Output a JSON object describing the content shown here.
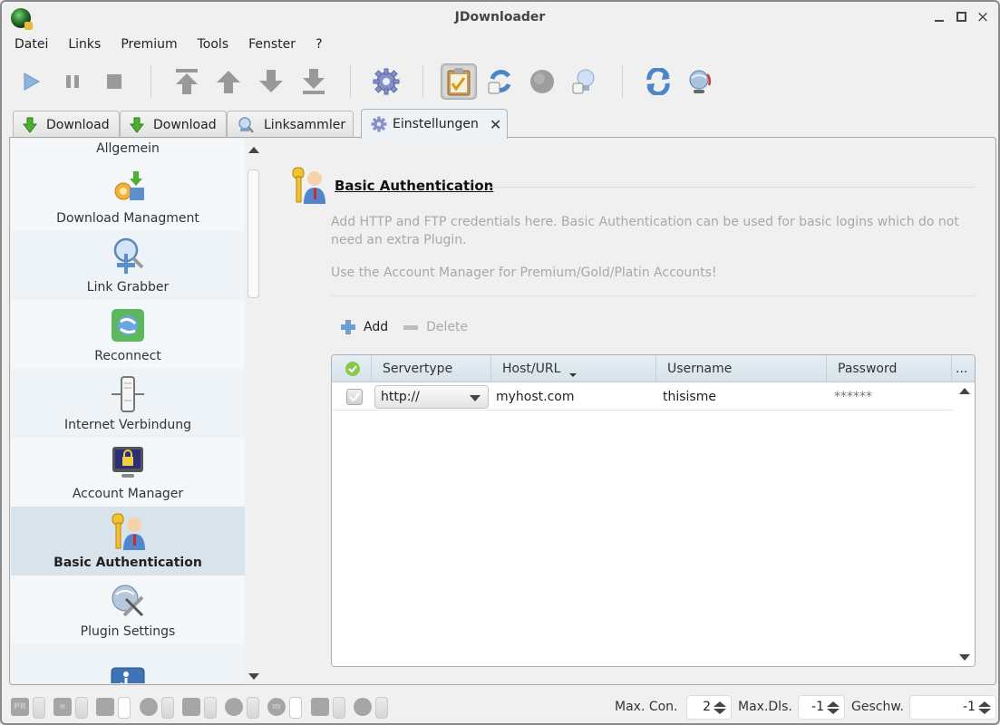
{
  "window": {
    "title": "JDownloader",
    "controls": {
      "minimize": "minimize",
      "maximize": "maximize",
      "close": "×"
    }
  },
  "menu": [
    "Datei",
    "Links",
    "Premium",
    "Tools",
    "Fenster",
    "?"
  ],
  "toolbar": {
    "buttons": [
      {
        "name": "play-icon",
        "tooltip": "Start"
      },
      {
        "name": "pause-icon",
        "tooltip": "Pause"
      },
      {
        "name": "stop-icon",
        "tooltip": "Stop"
      },
      {
        "name": "move-top-icon",
        "tooltip": "Move to top"
      },
      {
        "name": "move-up-icon",
        "tooltip": "Move up"
      },
      {
        "name": "move-down-icon",
        "tooltip": "Move down"
      },
      {
        "name": "move-bottom-icon",
        "tooltip": "Move to bottom"
      },
      {
        "name": "settings-gear-icon",
        "tooltip": "Settings"
      },
      {
        "name": "clipboard-check-icon",
        "tooltip": "Clipboard observer",
        "active": true
      },
      {
        "name": "auto-reconnect-icon",
        "tooltip": "Auto reconnect"
      },
      {
        "name": "premium-disabled-icon",
        "tooltip": "Premium"
      },
      {
        "name": "lightbulb-icon",
        "tooltip": "Tips"
      },
      {
        "name": "reconnect-icon",
        "tooltip": "Reconnect"
      },
      {
        "name": "update-globe-icon",
        "tooltip": "Update"
      }
    ]
  },
  "tabs": [
    {
      "label": "Download",
      "icon": "download-arrow-icon",
      "active": false
    },
    {
      "label": "Download",
      "icon": "download-arrow-icon",
      "active": false
    },
    {
      "label": "Linksammler",
      "icon": "linkgrabber-icon",
      "active": false
    },
    {
      "label": "Einstellungen",
      "icon": "settings-gear-icon",
      "active": true,
      "close": "✕"
    }
  ],
  "sidebar": {
    "header": "Allgemein",
    "items": [
      {
        "label": "Download Managment",
        "icon": "download-management-icon",
        "selected": false
      },
      {
        "label": "Link Grabber",
        "icon": "link-grabber-icon",
        "selected": false
      },
      {
        "label": "Reconnect",
        "icon": "reconnect-globe-icon",
        "selected": false
      },
      {
        "label": "Internet Verbindung",
        "icon": "server-connection-icon",
        "selected": false
      },
      {
        "label": "Account Manager",
        "icon": "monitor-lock-icon",
        "selected": false
      },
      {
        "label": "Basic Authentication",
        "icon": "key-user-icon",
        "selected": true
      },
      {
        "label": "Plugin Settings",
        "icon": "globe-tools-icon",
        "selected": false
      },
      {
        "label": "",
        "icon": "accessibility-settings-icon",
        "selected": false
      }
    ]
  },
  "panel": {
    "title": "Basic Authentication",
    "description": "Add HTTP and FTP credentials here. Basic Authentication can be used for basic logins which do not need an extra Plugin.",
    "note": "Use the Account Manager for Premium/Gold/Platin Accounts!",
    "add_label": "Add",
    "delete_label": "Delete",
    "table": {
      "columns": [
        "",
        "Servertype",
        "Host/URL",
        "Username",
        "Password",
        "..."
      ],
      "sorted_column": "Host/URL",
      "rows": [
        {
          "enabled": true,
          "servertype": "http://",
          "host": "myhost.com",
          "username": "thisisme",
          "password": "******"
        }
      ]
    }
  },
  "statusbar": {
    "plugin_icons": [
      "PR",
      "e",
      "",
      "",
      "",
      "",
      "m",
      "",
      ""
    ],
    "max_con_label": "Max. Con.",
    "max_con_value": "2",
    "max_dls_label": "Max.Dls.",
    "max_dls_value": "-1",
    "speed_label": "Geschw.",
    "speed_value": "-1"
  }
}
